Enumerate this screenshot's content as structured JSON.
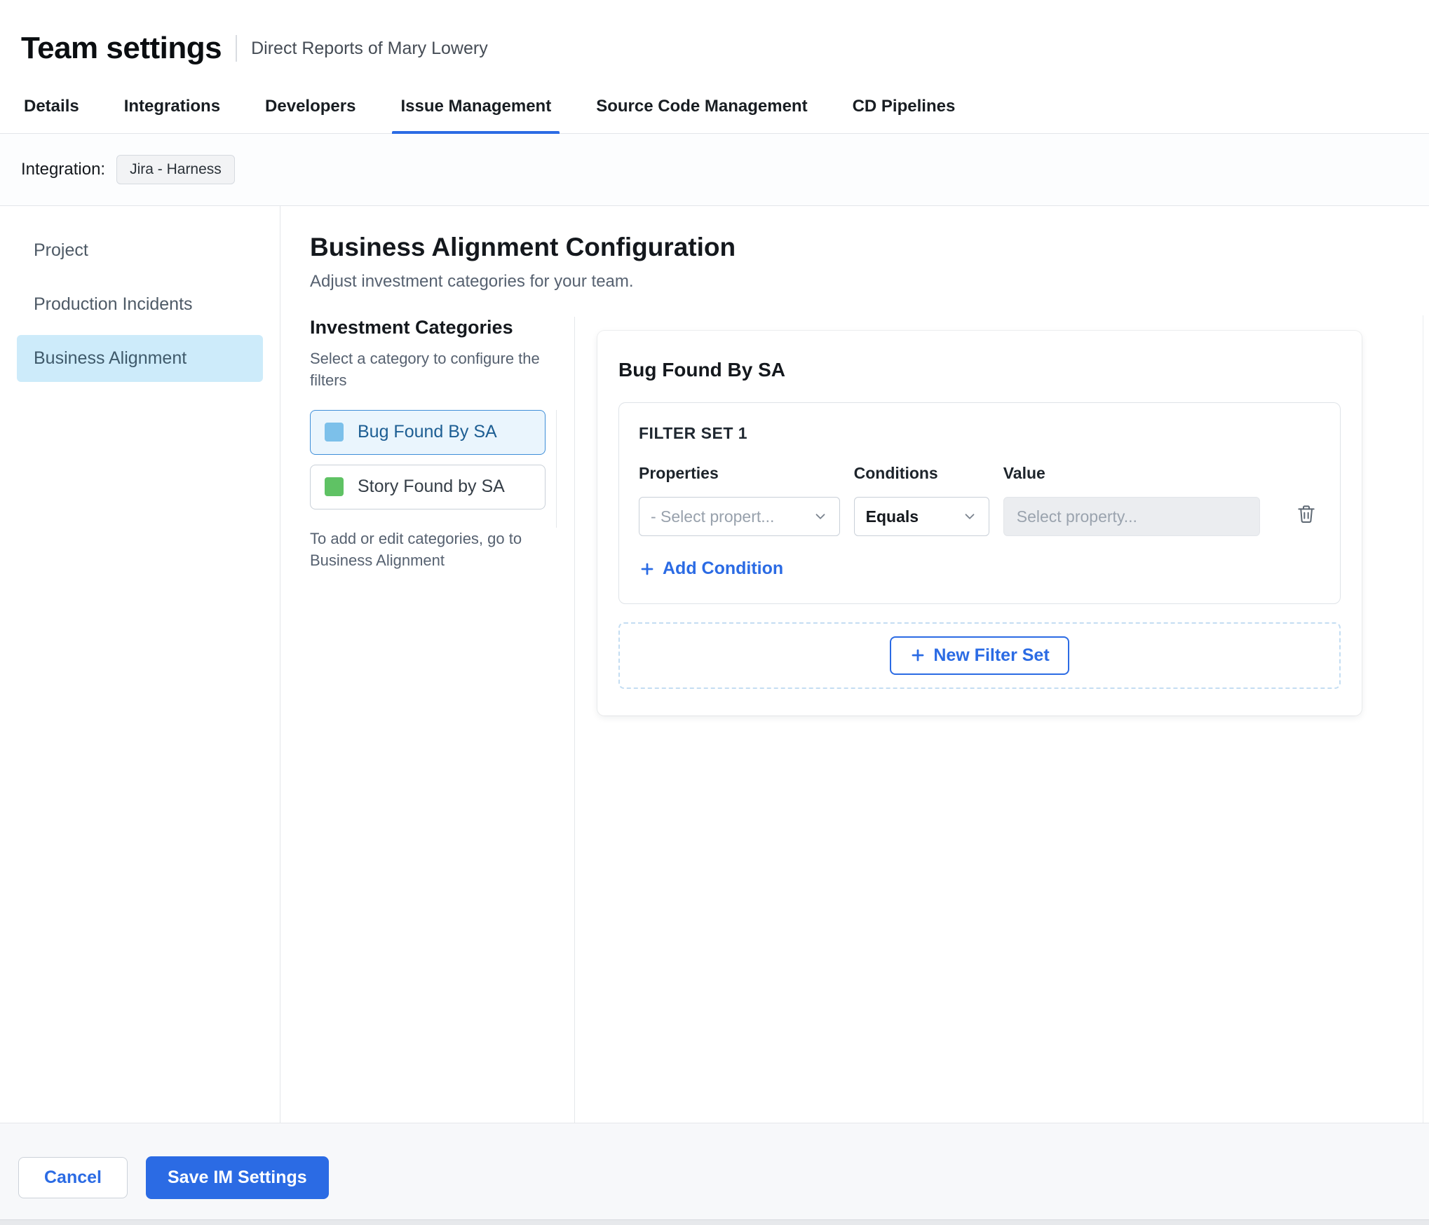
{
  "colors": {
    "accent": "#2b6be4",
    "tab_underline": "#2b6be4",
    "sidebar_selected_bg": "#cdebfa",
    "category_selected_bg": "#eaf5fd"
  },
  "header": {
    "title": "Team settings",
    "subtitle": "Direct Reports of Mary Lowery"
  },
  "tabs": [
    {
      "label": "Details"
    },
    {
      "label": "Integrations"
    },
    {
      "label": "Developers"
    },
    {
      "label": "Issue Management"
    },
    {
      "label": "Source Code Management"
    },
    {
      "label": "CD Pipelines"
    }
  ],
  "integration": {
    "label": "Integration:",
    "chip": "Jira - Harness"
  },
  "sidebar": {
    "items": [
      {
        "label": "Project"
      },
      {
        "label": "Production Incidents"
      },
      {
        "label": "Business Alignment"
      }
    ]
  },
  "main": {
    "title": "Business Alignment Configuration",
    "subtitle": "Adjust investment categories for your team.",
    "categories": {
      "title": "Investment Categories",
      "hint": "Select a category to configure the filters",
      "items": [
        {
          "label": "Bug Found By SA",
          "color": "#7cc0ea"
        },
        {
          "label": "Story Found by SA",
          "color": "#5fc264"
        }
      ],
      "footnote": "To add or edit categories, go to Business Alignment"
    },
    "panel": {
      "title": "Bug Found By SA",
      "filter_set": {
        "title": "FILTER SET 1",
        "columns": [
          "Properties",
          "Conditions",
          "Value"
        ],
        "property_placeholder": "- Select propert...",
        "condition_value": "Equals",
        "value_placeholder": "Select property...",
        "add_condition_label": "Add Condition"
      },
      "new_filter_set_label": "New Filter Set"
    }
  },
  "footer": {
    "cancel_label": "Cancel",
    "save_label": "Save IM Settings"
  }
}
